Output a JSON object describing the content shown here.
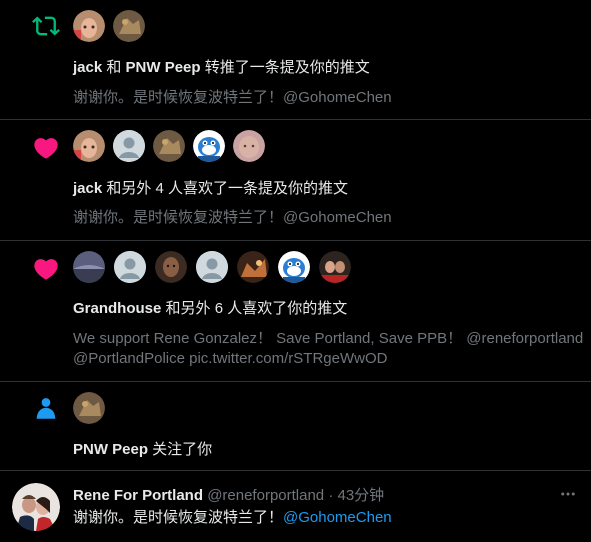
{
  "notifications": [
    {
      "type": "retweet",
      "actors_text": "jack",
      "connector": " 和 ",
      "actor2": "PNW Peep",
      "action": " 转推了一条提及你的推文",
      "body": "谢谢你。是时候恢复波特兰了！@GohomeChen"
    },
    {
      "type": "like",
      "actors_text": "jack",
      "action": " 和另外 4 人喜欢了一条提及你的推文",
      "body": "谢谢你。是时候恢复波特兰了！@GohomeChen"
    },
    {
      "type": "like",
      "actors_text": "Grandhouse",
      "action": " 和另外 6 人喜欢了你的推文",
      "body_line1": "We support Rene Gonzalez！ Save Portland, Save PPB！ @reneforportland",
      "body_line2": "@PortlandPolice pic.twitter.com/rSTRgeWwOD"
    },
    {
      "type": "follow",
      "actors_text": "PNW Peep",
      "action": " 关注了你"
    }
  ],
  "tweet": {
    "name": "Rene For Portland",
    "handle": "@reneforportland",
    "separator": " · ",
    "time": "43分钟",
    "text": "谢谢你。是时候恢复波特兰了！",
    "mention": "@GohomeChen"
  },
  "colors": {
    "retweet": "#00ba7c",
    "like": "#f91880",
    "follow": "#1d9bf0",
    "mention": "#1d9bf0"
  },
  "icons": [
    "retweet-icon",
    "heart-icon",
    "person-icon",
    "more-icon"
  ]
}
